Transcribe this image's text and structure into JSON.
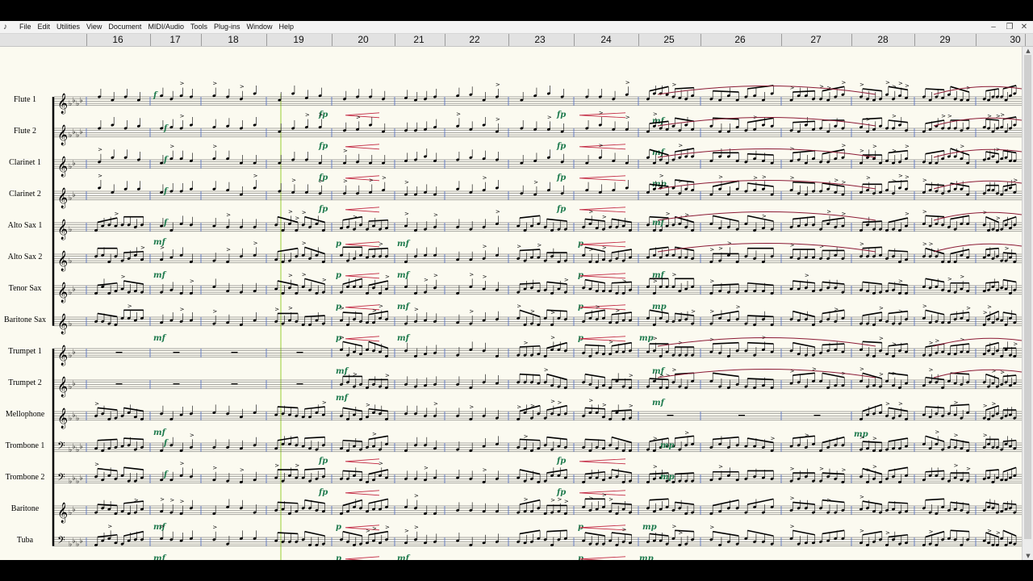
{
  "menu": {
    "items": [
      "File",
      "Edit",
      "Utilities",
      "View",
      "Document",
      "MIDI/Audio",
      "Tools",
      "Plug-ins",
      "Window",
      "Help"
    ]
  },
  "ruler": {
    "measures": [
      "16",
      "17",
      "18",
      "19",
      "20",
      "21",
      "22",
      "23",
      "24",
      "25",
      "26",
      "27",
      "28",
      "29",
      "30"
    ]
  },
  "instruments": [
    {
      "name": "Flute 1",
      "clef": "treble",
      "key": "flats4"
    },
    {
      "name": "Flute 2",
      "clef": "treble",
      "key": "flats4"
    },
    {
      "name": "Clarinet 1",
      "clef": "treble",
      "key": "flats2"
    },
    {
      "name": "Clarinet 2",
      "clef": "treble",
      "key": "flats2"
    },
    {
      "name": "Alto Sax 1",
      "clef": "treble",
      "key": "flats1"
    },
    {
      "name": "Alto Sax 2",
      "clef": "treble",
      "key": "flats1"
    },
    {
      "name": "Tenor Sax",
      "clef": "treble",
      "key": "flats2"
    },
    {
      "name": "Baritone Sax",
      "clef": "treble",
      "key": "flats1"
    },
    {
      "name": "Trumpet 1",
      "clef": "treble",
      "key": "flats2"
    },
    {
      "name": "Trumpet 2",
      "clef": "treble",
      "key": "flats2"
    },
    {
      "name": "Mellophone",
      "clef": "treble",
      "key": "flats3"
    },
    {
      "name": "Trombone 1",
      "clef": "bass",
      "key": "flats4"
    },
    {
      "name": "Trombone 2",
      "clef": "bass",
      "key": "flats4"
    },
    {
      "name": "Baritone",
      "clef": "treble",
      "key": "flats2"
    },
    {
      "name": "Tuba",
      "clef": "bass",
      "key": "flats4"
    }
  ],
  "dynamics": {
    "f": "f",
    "fp": "fp",
    "mf": "mf",
    "mp": "mp",
    "p": "p"
  },
  "colors": {
    "dynamic": "#1e7a4d",
    "slur": "#8b1a35",
    "hairpin": "#c2243f",
    "measure_line": "#4a67c4",
    "playback": "#9acd32"
  }
}
